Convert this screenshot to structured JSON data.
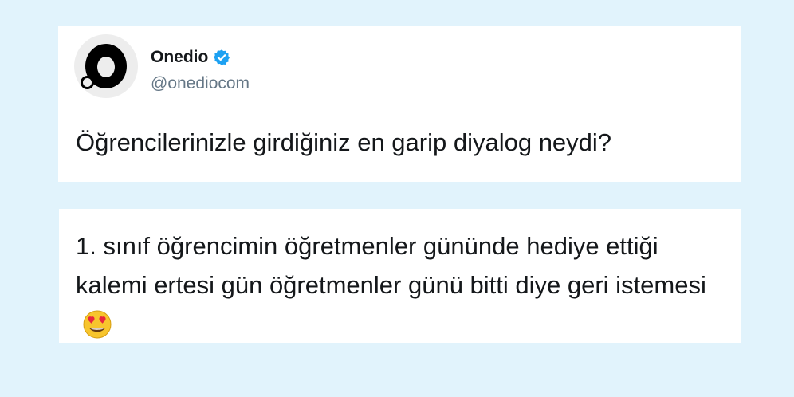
{
  "tweet": {
    "display_name": "Onedio",
    "handle": "@onediocom",
    "verified_icon": "verified-badge-icon",
    "avatar_icon": "onedio-logo-icon",
    "text": "Öğrencilerinizle girdiğiniz en garip diyalog neydi?"
  },
  "reply": {
    "text": "1. sınıf öğrencimin öğretmenler gününde hediye ettiği kalemi ertesi gün öğretmenler günü bitti diye geri istemesi",
    "emoji_icon": "heart-eyes-emoji-icon"
  },
  "colors": {
    "background": "#e1f3fc",
    "card": "#ffffff",
    "verified": "#1da1f2",
    "handle": "#657786",
    "text": "#14171a"
  }
}
